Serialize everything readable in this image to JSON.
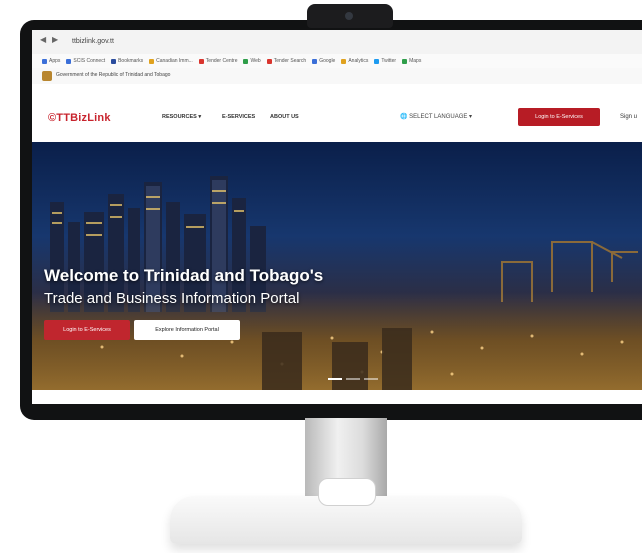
{
  "browser": {
    "url": "ttbizlink.gov.tt",
    "back_glyph": "◀",
    "forward_glyph": "▶",
    "bookmarks": [
      {
        "label": "Apps",
        "color": "#3b6fd8"
      },
      {
        "label": "SCIS Connect",
        "color": "#3b6fd8"
      },
      {
        "label": "Bookmarks",
        "color": "#2b4d9e"
      },
      {
        "label": "Canadian Imm...",
        "color": "#e0a21f"
      },
      {
        "label": "Tender Centre",
        "color": "#d9352e"
      },
      {
        "label": "Web",
        "color": "#2f9e4a"
      },
      {
        "label": "Tender Search",
        "color": "#d9352e"
      },
      {
        "label": "Google",
        "color": "#3b6fd8"
      },
      {
        "label": "Analytics",
        "color": "#e0a21f"
      },
      {
        "label": "Twitter",
        "color": "#1d9bf0"
      },
      {
        "label": "Maps",
        "color": "#2f9e4a"
      }
    ]
  },
  "gov_banner": {
    "text": "Government of the Republic of Trinidad and Tobago",
    "icon": "coat-of-arms-icon"
  },
  "header": {
    "logo": "©TTBizLink",
    "nav": [
      "RESOURCES ▾",
      "E-SERVICES",
      "ABOUT US"
    ],
    "language": "🌐 SELECT LANGUAGE ▾",
    "login": "Login to E-Services",
    "signup": "Sign u"
  },
  "hero": {
    "title": "Welcome to Trinidad and Tobago's",
    "subtitle": "Trade and Business Information Portal",
    "primary_button": "Login to E-Services",
    "secondary_button": "Explore Information Portal"
  },
  "colors": {
    "brand_red": "#c8242e",
    "bezel": "#111213",
    "hero_sky": "#17376e"
  }
}
